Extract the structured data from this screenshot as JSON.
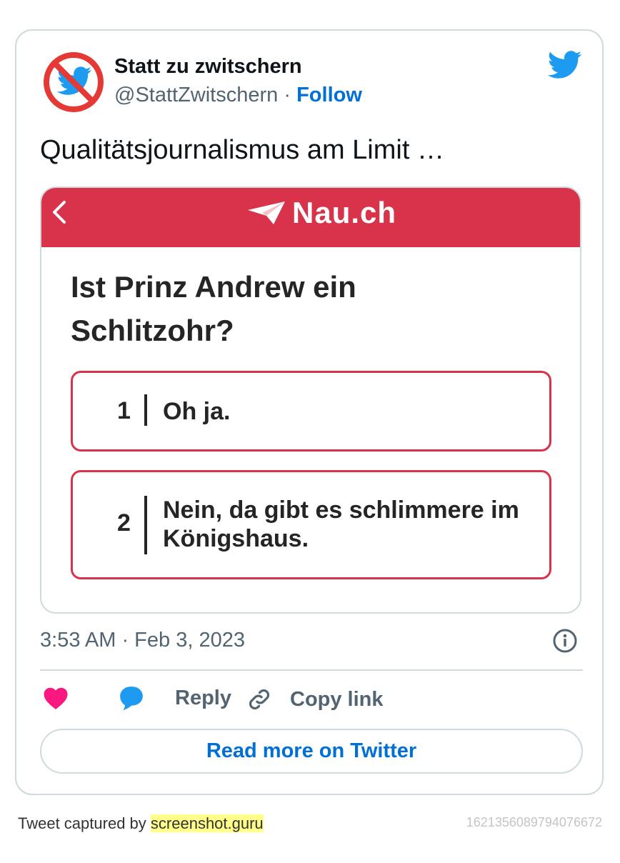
{
  "author": {
    "name": "Statt zu zwitschern",
    "handle": "@StattZwitschern",
    "separator": "·",
    "follow_label": "Follow"
  },
  "tweet": {
    "text": "Qualitätsjournalismus am Limit …",
    "timestamp": "3:53 AM · Feb 3, 2023"
  },
  "media": {
    "brand": "Nau.ch",
    "question": "Ist Prinz Andrew ein Schlitzohr?",
    "options": [
      {
        "number": "1",
        "text": "Oh ja."
      },
      {
        "number": "2",
        "text": "Nein, da gibt es schlimmere im Königshaus."
      }
    ],
    "brand_color": "#d8334a"
  },
  "actions": {
    "reply_label": "Reply",
    "copy_label": "Copy link",
    "read_more_label": "Read more on Twitter"
  },
  "footer": {
    "captured_prefix": "Tweet captured by",
    "captured_link": "screenshot.guru",
    "tweet_id": "1621356089794076672"
  },
  "icons": [
    "no-twitter-avatar",
    "twitter-bird-icon",
    "back-chevron-icon",
    "paper-plane-icon",
    "info-icon",
    "heart-icon",
    "reply-bubble-icon",
    "link-icon"
  ],
  "colors": {
    "accent": "#006fd6",
    "heart": "#f91880",
    "reply": "#1d9bf0",
    "twitter": "#1d9bf0"
  }
}
